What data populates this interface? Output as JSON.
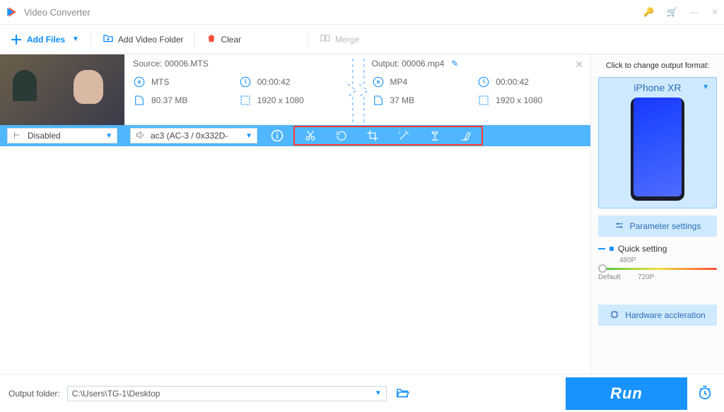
{
  "window": {
    "title": "Video Converter"
  },
  "toolbar": {
    "addFiles": "Add Files",
    "addFolder": "Add Video Folder",
    "clear": "Clear",
    "merge": "Merge"
  },
  "file": {
    "sourceLabel": "Source: 00006.MTS",
    "outputLabel": "Output: 00006.mp4",
    "src": {
      "format": "MTS",
      "duration": "00:00:42",
      "size": "80.37 MB",
      "dims": "1920 x 1080"
    },
    "out": {
      "format": "MP4",
      "duration": "00:00:42",
      "size": "37 MB",
      "dims": "1920 x 1080"
    }
  },
  "strip": {
    "subtitle": "Disabled",
    "audio": "ac3 (AC-3 / 0x332D-"
  },
  "right": {
    "changeFormat": "Click to change output format:",
    "device": "iPhone XR",
    "paramSettings": "Parameter settings",
    "quickSetting": "Quick setting",
    "p480": "480P",
    "p720": "720P",
    "default": "Default",
    "hwAccel": "Hardware accleration"
  },
  "footer": {
    "outLabel": "Output folder:",
    "outPath": "C:\\Users\\TG-1\\Desktop",
    "run": "Run"
  }
}
